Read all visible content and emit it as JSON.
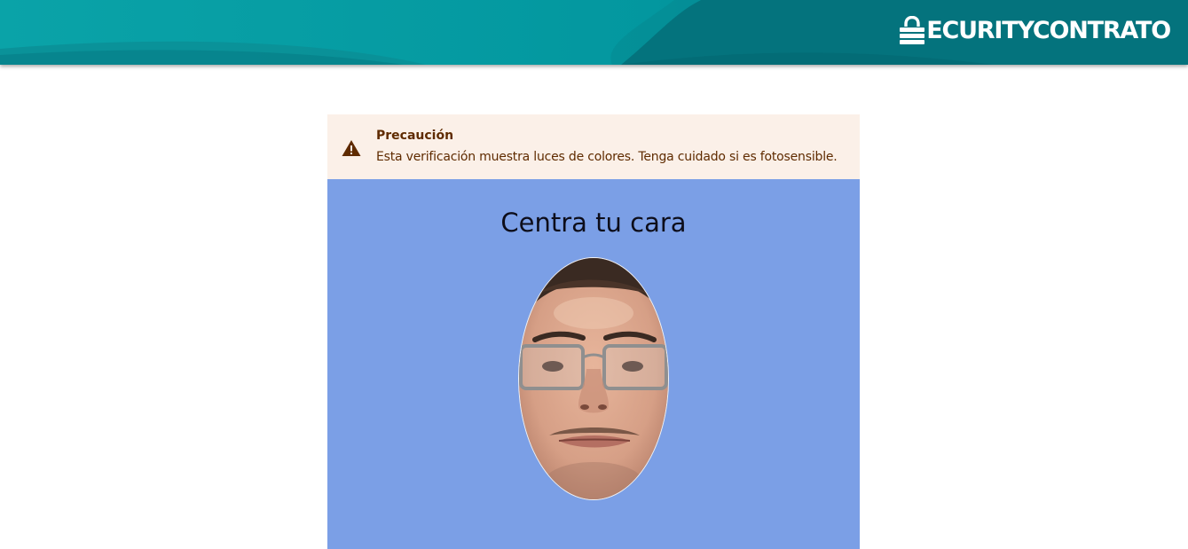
{
  "header": {
    "brand_name": "ECURITYCONTRATO",
    "brand_icon": "lock-icon",
    "colors": {
      "teal_light": "#0aa6ab",
      "teal_dark": "#046f78"
    }
  },
  "alert": {
    "icon": "warning-icon",
    "title": "Precaución",
    "message": "Esta verificación muestra luces de colores. Tenga cuidado si es fotosensible.",
    "background": "#fbf0e8",
    "text_color": "#5f2b00"
  },
  "verification": {
    "instruction": "Centra tu cara",
    "background": "#7b9fe6"
  }
}
